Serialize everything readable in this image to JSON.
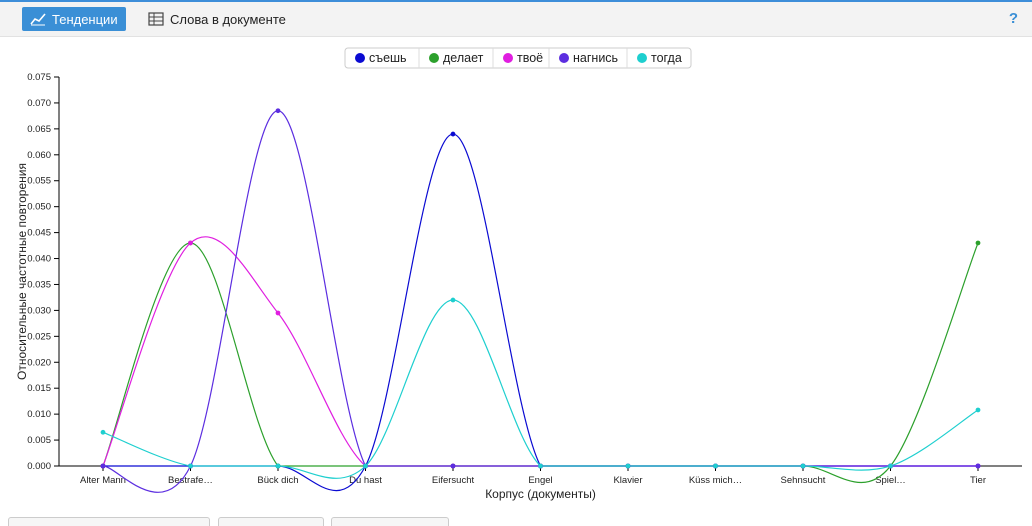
{
  "toolbar": {
    "tabs": [
      {
        "label": "Тенденции",
        "icon": "line-chart-icon",
        "active": true
      },
      {
        "label": "Слова в документе",
        "icon": "table-icon",
        "active": false
      }
    ],
    "help_label": "?"
  },
  "colors": {
    "accent": "#3a8fd6"
  },
  "chart_data": {
    "type": "line",
    "xlabel": "Корпус (документы)",
    "ylabel": "Относительные частотные повторения",
    "categories": [
      "Alter Mann",
      "Bestrafe…",
      "Bück dich",
      "Du hast",
      "Eifersucht",
      "Engel",
      "Klavier",
      "Küss mich…",
      "Sehnsucht",
      "Spiel…",
      "Tier"
    ],
    "ylim": [
      0,
      0.075
    ],
    "yticks": [
      "0.000",
      "0.005",
      "0.010",
      "0.015",
      "0.020",
      "0.025",
      "0.030",
      "0.035",
      "0.040",
      "0.045",
      "0.050",
      "0.055",
      "0.060",
      "0.065",
      "0.070",
      "0.075"
    ],
    "legend_position": "top",
    "series": [
      {
        "name": "съешь",
        "color": "#0a0ad2",
        "values": [
          0,
          0,
          0,
          0,
          0.064,
          0,
          0,
          0,
          0,
          0,
          0
        ]
      },
      {
        "name": "делает",
        "color": "#2ca02c",
        "values": [
          0,
          0.043,
          0,
          0,
          0,
          0,
          0,
          0,
          0,
          0,
          0.043
        ]
      },
      {
        "name": "твоё",
        "color": "#e01ee0",
        "values": [
          0,
          0.043,
          0.0295,
          0,
          0,
          0,
          0,
          0,
          0,
          0,
          0
        ]
      },
      {
        "name": "нагнись",
        "color": "#5c2ee0",
        "values": [
          0,
          0,
          0.0685,
          0,
          0,
          0,
          0,
          0,
          0,
          0,
          0
        ]
      },
      {
        "name": "тогда",
        "color": "#1ecfcf",
        "values": [
          0.0065,
          0,
          0,
          0,
          0.032,
          0,
          0,
          0,
          0,
          0,
          0.0108
        ]
      }
    ]
  }
}
